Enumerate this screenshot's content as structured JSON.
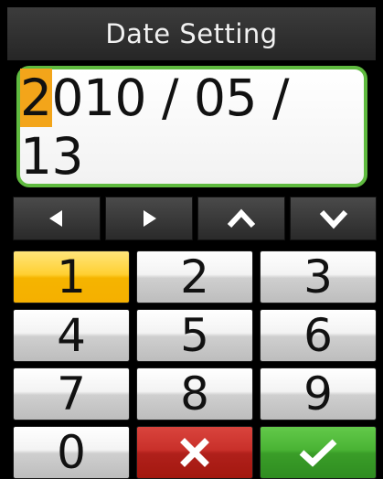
{
  "title": "Date Setting",
  "date": {
    "cursor_char": "2",
    "rest": "010 / 05 / 13"
  },
  "nav": {
    "left_icon": "left-arrow-icon",
    "right_icon": "right-arrow-icon",
    "up_icon": "chevron-up-icon",
    "down_icon": "chevron-down-icon"
  },
  "keypad": {
    "k1": "1",
    "k2": "2",
    "k3": "3",
    "k4": "4",
    "k5": "5",
    "k6": "6",
    "k7": "7",
    "k8": "8",
    "k9": "9",
    "k0": "0",
    "cancel_icon": "close-icon",
    "ok_icon": "check-icon"
  },
  "colors": {
    "highlight": "#f3a51a",
    "active_key": "#ffd032",
    "cancel": "#c9302a",
    "ok": "#49b334",
    "frame": "#5fba3f"
  }
}
